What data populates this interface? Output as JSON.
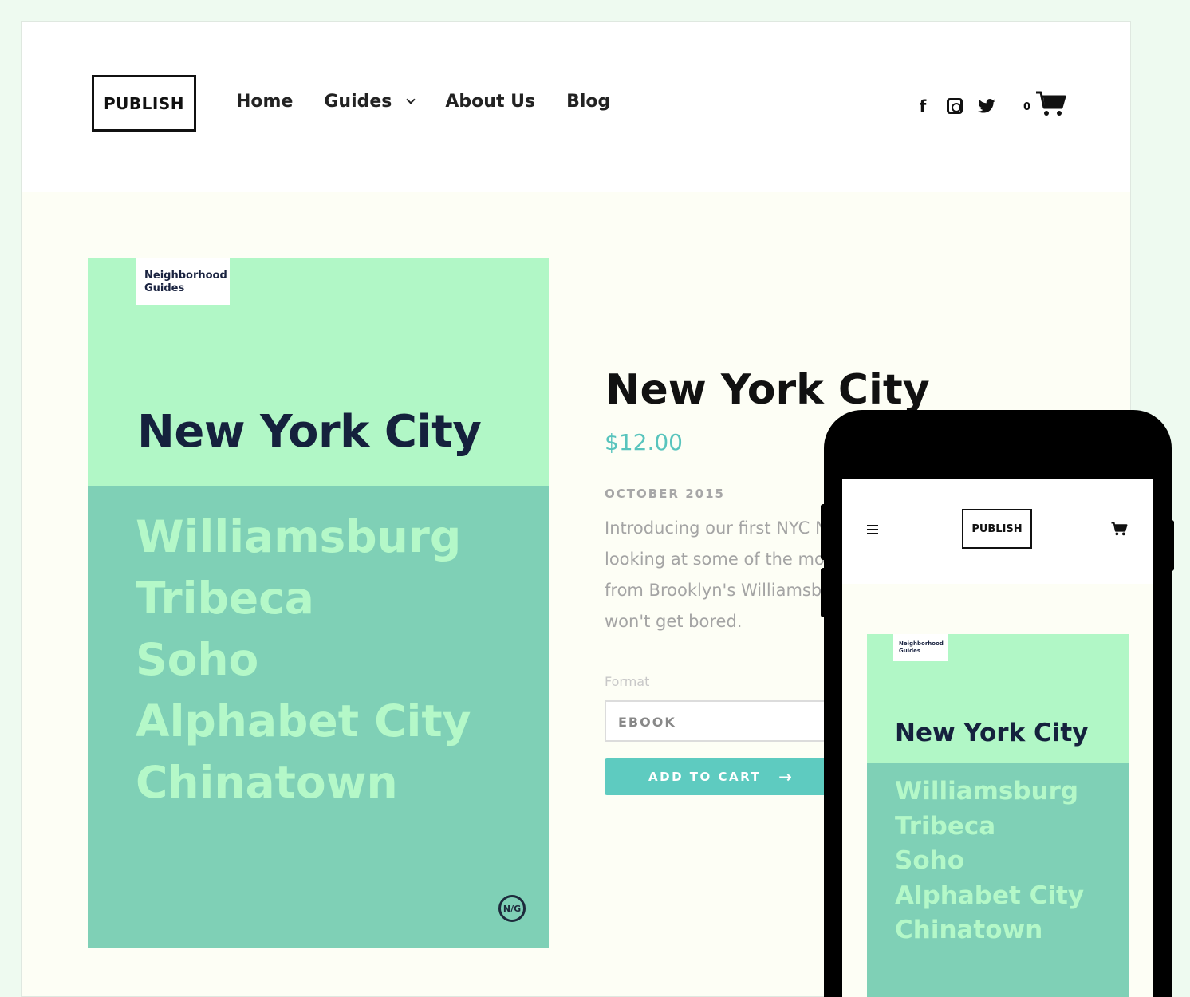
{
  "desktop": {
    "header": {
      "logo": "PUBLISH",
      "nav": [
        {
          "label": "Home"
        },
        {
          "label": "Guides",
          "has_dropdown": true
        },
        {
          "label": "About Us"
        },
        {
          "label": "Blog"
        }
      ],
      "social_icons": [
        "facebook-icon",
        "instagram-icon",
        "twitter-icon"
      ],
      "facebook_glyph": "f",
      "twitter_glyph": "🐦",
      "cart_count": "0"
    },
    "cover": {
      "tag_line1": "Neighborhood",
      "tag_line2": "Guides",
      "title": "New York City",
      "neighborhoods": [
        "Williamsburg",
        "Tribeca",
        "Soho",
        "Alphabet City",
        "Chinatown"
      ],
      "badge": "N/G"
    },
    "product": {
      "title": "New York City",
      "price": "$12.00",
      "date": "OCTOBER 2015",
      "description_lines": [
        "Introducing our first NYC N",
        "looking at some of the mo",
        "from Brooklyn's Williamsb",
        "won't get bored."
      ],
      "format_label": "Format",
      "format_value": "EBOOK",
      "add_to_cart": "ADD TO CART",
      "arrow": "→"
    }
  },
  "mobile": {
    "logo": "PUBLISH",
    "cover": {
      "tag_line1": "Neighborhood",
      "tag_line2": "Guides",
      "title": "New York City",
      "neighborhoods": [
        "Williamsburg",
        "Tribeca",
        "Soho",
        "Alphabet City",
        "Chinatown"
      ]
    }
  },
  "colors": {
    "cover_light": "#b1f7c6",
    "cover_dark": "#7fd0b6",
    "accent": "#5ecbc0",
    "price": "#58c4bd",
    "navy": "#15213d"
  }
}
